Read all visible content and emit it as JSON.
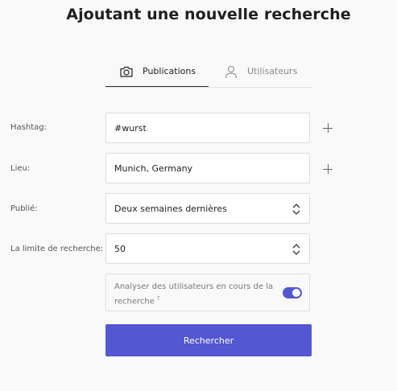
{
  "page": {
    "title": "Ajoutant une nouvelle recherche"
  },
  "tabs": [
    {
      "label": "Publications",
      "icon": "camera-icon",
      "active": true
    },
    {
      "label": "Utilisateurs",
      "icon": "user-icon",
      "active": false
    }
  ],
  "form": {
    "hashtag": {
      "label": "Hashtag:",
      "value": "#wurst"
    },
    "lieu": {
      "label": "Lieu:",
      "value": "Munich, Germany"
    },
    "publie": {
      "label": "Publié:",
      "selected": "Deux semaines dernières"
    },
    "limite": {
      "label": "La limite de recherche:",
      "value": "50"
    },
    "analyse": {
      "text": "Analyser des utilisateurs en cours de la recherche",
      "help": "?",
      "enabled": true
    },
    "submit_label": "Rechercher"
  },
  "colors": {
    "accent": "#5357d1",
    "page_bg": "#f9f9f9",
    "border": "#dedede"
  }
}
